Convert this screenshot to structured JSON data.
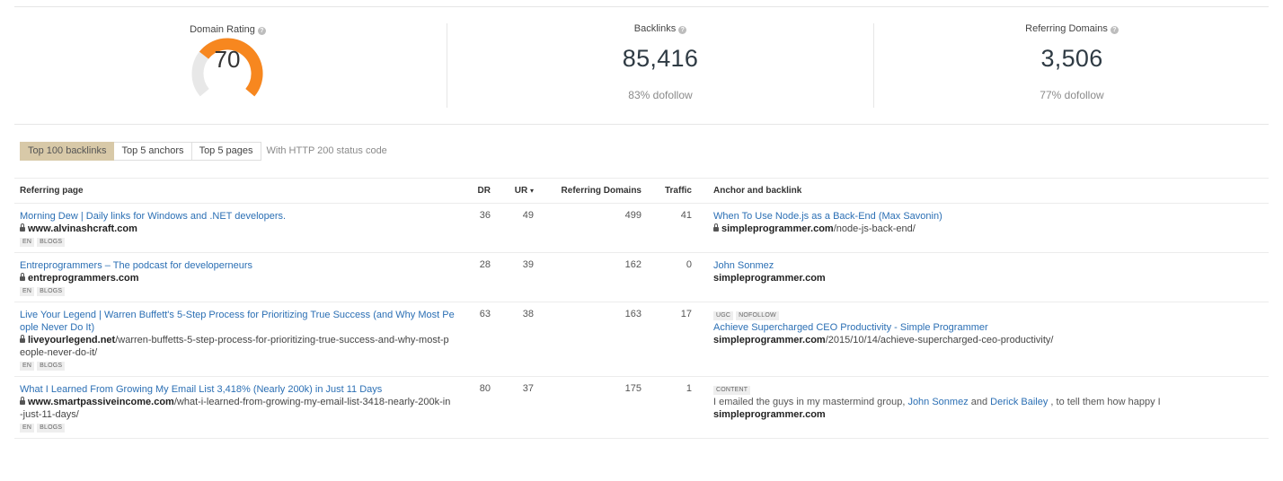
{
  "stats": {
    "domain_rating": {
      "label": "Domain Rating",
      "value": "70",
      "fill": 0.7,
      "color": "#f7871f",
      "track": "#e8e8e8"
    },
    "backlinks": {
      "label": "Backlinks",
      "value": "85,416",
      "sub": "83% dofollow"
    },
    "referring_domains": {
      "label": "Referring Domains",
      "value": "3,506",
      "sub": "77% dofollow"
    }
  },
  "tabs": [
    {
      "label": "Top 100 backlinks",
      "active": true
    },
    {
      "label": "Top 5 anchors",
      "active": false
    },
    {
      "label": "Top 5 pages",
      "active": false
    }
  ],
  "tabs_note": "With HTTP 200 status code",
  "columns": {
    "referring_page": "Referring page",
    "dr": "DR",
    "ur": "UR",
    "ur_sort": "▾",
    "referring_domains": "Referring Domains",
    "traffic": "Traffic",
    "anchor": "Anchor and backlink"
  },
  "rows": [
    {
      "title": "Morning Dew | Daily links for Windows and .NET developers.",
      "domain": "www.alvinashcraft.com",
      "path": "",
      "tags": [
        "EN",
        "BLOGS"
      ],
      "dr": "36",
      "ur": "49",
      "rd": "499",
      "traffic": "41",
      "anchor_tags": [],
      "anchor_text": "When To Use Node.js as a Back-End (Max Savonin)",
      "anchor_is_link": true,
      "target_domain": "simpleprogrammer.com",
      "target_path": "/node-js-back-end/",
      "target_lock": true
    },
    {
      "title": "Entreprogrammers – The podcast for developerneurs",
      "domain": "entreprogrammers.com",
      "path": "",
      "tags": [
        "EN",
        "BLOGS"
      ],
      "dr": "28",
      "ur": "39",
      "rd": "162",
      "traffic": "0",
      "anchor_tags": [],
      "anchor_text": "John Sonmez",
      "anchor_is_link": true,
      "target_domain": "simpleprogrammer.com",
      "target_path": "",
      "target_lock": false
    },
    {
      "title_line1": "Live Your Legend | Warren Buffett's 5-Step Process for Prioritizing True Success (and Why Most Pe",
      "title_line2": "ople Never Do It)",
      "domain": "liveyourlegend.net",
      "path_line1": "/warren-buffetts-5-step-process-for-prioritizing-true-success-and-why-most-p",
      "path_line2": "eople-never-do-it/",
      "tags": [
        "EN",
        "BLOGS"
      ],
      "dr": "63",
      "ur": "38",
      "rd": "163",
      "traffic": "17",
      "anchor_tags": [
        "UGC",
        "NOFOLLOW"
      ],
      "anchor_text": "Achieve Supercharged CEO Productivity - Simple Programmer",
      "anchor_is_link": true,
      "target_domain": "simpleprogrammer.com",
      "target_path": "/2015/10/14/achieve-supercharged-ceo-productivity/",
      "target_lock": false
    },
    {
      "title": "What I Learned From Growing My Email List 3,418% (Nearly 200k) in Just 11 Days",
      "domain": "www.smartpassiveincome.com",
      "path_line1": "/what-i-learned-from-growing-my-email-list-3418-nearly-200k-in",
      "path_line2": "-just-11-days/",
      "tags": [
        "EN",
        "BLOGS"
      ],
      "dr": "80",
      "ur": "37",
      "rd": "175",
      "traffic": "1",
      "anchor_tags": [
        "CONTENT"
      ],
      "anchor_pre": "I emailed the guys in my mastermind group, ",
      "anchor_link1": "John Sonmez",
      "anchor_mid": " and ",
      "anchor_link2": "Derick Bailey",
      "anchor_post": " , to tell them how happy I",
      "target_domain": "simpleprogrammer.com",
      "target_path": "",
      "target_lock": false
    }
  ]
}
